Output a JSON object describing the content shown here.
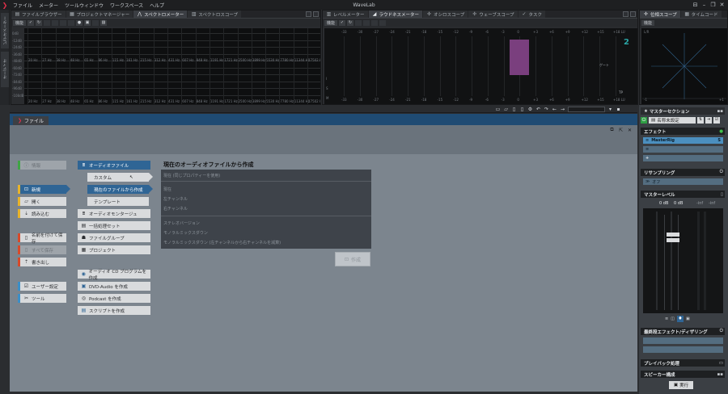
{
  "app": {
    "title": "WaveLab",
    "menu": [
      "ファイル",
      "メーター",
      "ツールウィンドウ",
      "ワークスペース",
      "ヘルプ"
    ],
    "window_controls": [
      "⊟",
      "–",
      "❐",
      "✕"
    ]
  },
  "left_strip": {
    "tabs": [
      "ビデオメーター",
      "オーディオ"
    ]
  },
  "spectrum_panel": {
    "tabs": [
      "ファイルブラウザー",
      "プロジェクトマネージャー",
      "スペクトロメーター",
      "スペクトロスコープ"
    ],
    "toolbar_label": "機能",
    "y_labels": [
      "0dB",
      "-12dB",
      "-24dB",
      "-36dB",
      "-48dB",
      "-60dB",
      "-72dB",
      "-84dB",
      "-96dB",
      "-108dB"
    ],
    "x_labels": [
      "20 Hz",
      "27 Hz",
      "38 Hz",
      "48 Hz",
      "65 Hz",
      "86 Hz",
      "115 Hz",
      "161 Hz",
      "215 Hz",
      "312 Hz",
      "431 Hz",
      "607 Hz",
      "848 Hz",
      "1191 Hz",
      "1721 Hz",
      "2500 Hz",
      "3899 Hz",
      "5530 Hz",
      "7780 Hz",
      "11344 Hz",
      "17502 Hz"
    ]
  },
  "loudness_panel": {
    "tabs": [
      "レベルメーター",
      "ラウドネスメーター",
      "オシロスコープ",
      "ウェーブスコープ",
      "タスク"
    ],
    "toolbar_label": "機能",
    "scale": [
      "-33",
      "-30",
      "-27",
      "-24",
      "-21",
      "-18",
      "-15",
      "-12",
      "-9",
      "-6",
      "-3",
      "0",
      "+3",
      "+6",
      "+9",
      "+12",
      "+15",
      "+18 LU"
    ],
    "rows": [
      "I",
      "S",
      "M"
    ],
    "side_labels": {
      "gate": "ゲート",
      "tp": "TP"
    },
    "bar_value_lu": 0
  },
  "phase_panel": {
    "tabs": [
      "位相スコープ",
      "タイムコード"
    ],
    "toolbar_label": "機能",
    "corner_labels": {
      "top_left": "L/R",
      "bottom_left": "-1",
      "bottom_right": "+1"
    }
  },
  "file_tab": {
    "label": "ファイル"
  },
  "nav": {
    "info": "情報",
    "new": "新規",
    "open": "開く",
    "import": "読み込む",
    "save_as": "名前を付けて保存",
    "save_all": "すべて保存",
    "export": "書き出し",
    "preferences": "ユーザー設定",
    "tools": "ツール"
  },
  "sub": {
    "audio_file": "オーディオファイル",
    "custom": "カスタム",
    "from_current": "現在のファイルから作成",
    "template": "テンプレート",
    "audio_montage": "オーディオモンタージュ",
    "batch": "一括処理セット",
    "file_group": "ファイルグループ",
    "project": "プロジェクト",
    "audio_cd": "オーディオ CD プログラムを作成",
    "dvd_audio": "DVD-Audio を作成",
    "podcast": "Podcast を作成",
    "script": "スクリプトを作成"
  },
  "create_panel": {
    "title": "現在のオーディオファイルから作成",
    "items": [
      "現在 (同じプロパティーを使用)",
      "現在",
      "左チャンネル",
      "右チャンネル",
      "ステレオバージョン",
      "モノラルミックスダウン",
      "モノラルミックスダウン (左チャンネルから右チャンネルを減算)"
    ],
    "create_button": "作成"
  },
  "master": {
    "title": "マスターセクション",
    "preset": "名称未設定",
    "effects_label": "エフェクト",
    "effect_slot": "MasterRig",
    "resampling_label": "リサンプリング",
    "resampling_value": "オフ",
    "master_level_label": "マスターレベル",
    "level_left": "0 dB",
    "level_right": "0 dB",
    "level_inf_l": "-inf",
    "level_inf_r": "-inf",
    "final_label": "最終段エフェクト/ディザリング",
    "playback_label": "プレイバック処理",
    "speaker_label": "スピーカー構成",
    "render_button": "実行"
  }
}
